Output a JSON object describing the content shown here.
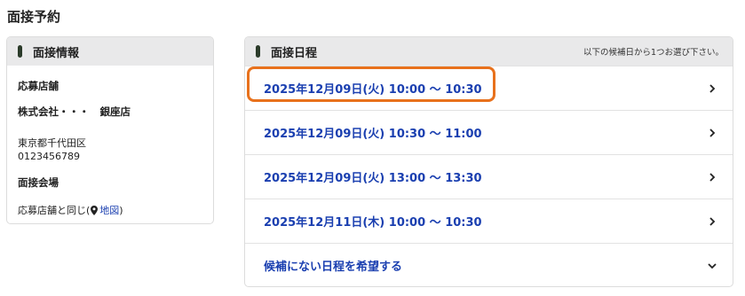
{
  "page": {
    "title": "面接予約"
  },
  "info": {
    "header": "面接情報",
    "shop_label": "応募店舗",
    "shop_name": "株式会社・・・ 銀座店",
    "address": "東京都千代田区",
    "phone": "0123456789",
    "venue_label": "面接会場",
    "venue_text": "応募店舗と同じ(",
    "map_link": "地図",
    "venue_close": ")"
  },
  "schedule": {
    "header": "面接日程",
    "note": "以下の候補日から1つお選び下さい。",
    "slots": [
      {
        "label": "2025年12月09日(火) 10:00 〜 10:30"
      },
      {
        "label": "2025年12月09日(火) 10:30 〜 11:00"
      },
      {
        "label": "2025年12月09日(火) 13:00 〜 13:30"
      },
      {
        "label": "2025年12月11日(木) 10:00 〜 10:30"
      }
    ],
    "other": "候補にない日程を希望する"
  },
  "colors": {
    "link": "#1a3fb0",
    "highlight": "#e8711c",
    "header_bg": "#e9e9ea",
    "header_bar": "#2b3b2a"
  }
}
